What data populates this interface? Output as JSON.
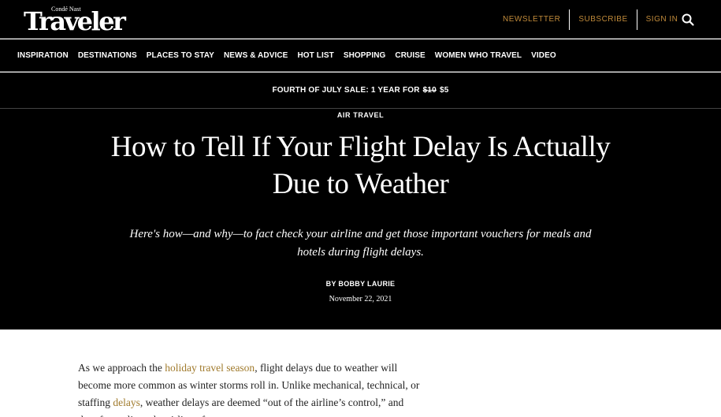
{
  "brand": {
    "sup": "Condé Nast",
    "name": "Traveler"
  },
  "utility_nav": {
    "newsletter": "NEWSLETTER",
    "subscribe": "SUBSCRIBE",
    "sign_in": "SIGN IN",
    "accent_color": "#c08a3a"
  },
  "nav": {
    "items": [
      "INSPIRATION",
      "DESTINATIONS",
      "PLACES TO STAY",
      "NEWS & ADVICE",
      "HOT LIST",
      "SHOPPING",
      "CRUISE",
      "WOMEN WHO TRAVEL",
      "VIDEO"
    ]
  },
  "promo": {
    "text": "FOURTH OF JULY SALE: 1 YEAR FOR",
    "old_price": "$10",
    "new_price": "$5"
  },
  "article": {
    "rubric": "AIR TRAVEL",
    "headline": "How to Tell If Your Flight Delay Is Actually Due to Weather",
    "dek": "Here's how—and why—to fact check your airline and get those important vouchers for meals and hotels during flight delays.",
    "byline_prefix": "BY",
    "author": "BOBBY LAURIE",
    "date": "November 22, 2021",
    "body": {
      "p1_a": "As we approach the ",
      "p1_link1": "holiday travel season",
      "p1_b": ", flight delays due to weather will become more common as winter storms roll in. Unlike mechanical, technical, or staffing ",
      "p1_link2": "delays",
      "p1_c": ", weather delays are deemed “out of the airline’s control,” and therefore relieve the airline of"
    }
  }
}
